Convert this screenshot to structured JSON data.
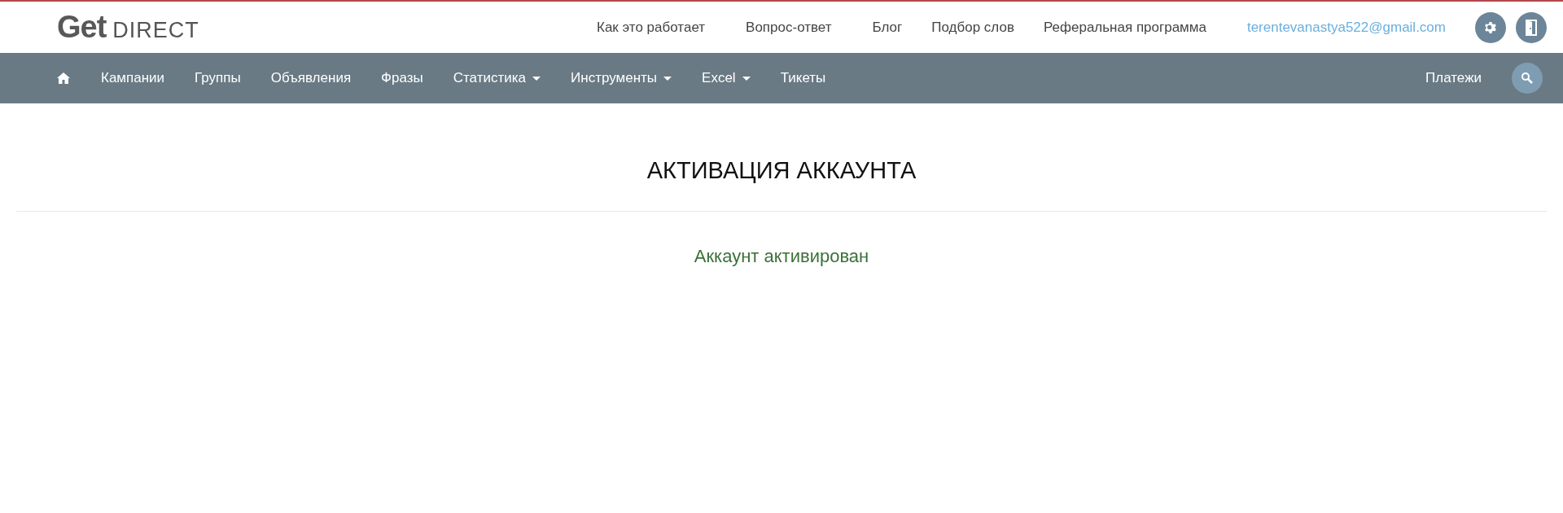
{
  "logo": {
    "mark": "Get",
    "word": "DIRECT"
  },
  "top_links": [
    "Как это работает",
    "Вопрос-ответ",
    "Блог",
    "Подбор слов",
    "Реферальная программа"
  ],
  "user_email": "terentevanastya522@gmail.com",
  "nav_items": [
    {
      "label": "Кампании",
      "dropdown": false
    },
    {
      "label": "Группы",
      "dropdown": false
    },
    {
      "label": "Объявления",
      "dropdown": false
    },
    {
      "label": "Фразы",
      "dropdown": false
    },
    {
      "label": "Статистика",
      "dropdown": true
    },
    {
      "label": "Инструменты",
      "dropdown": true
    },
    {
      "label": "Excel",
      "dropdown": true
    },
    {
      "label": "Тикеты",
      "dropdown": false
    }
  ],
  "nav_right": "Платежи",
  "page_title": "АКТИВАЦИЯ АККАУНТА",
  "message": "Аккаунт активирован"
}
